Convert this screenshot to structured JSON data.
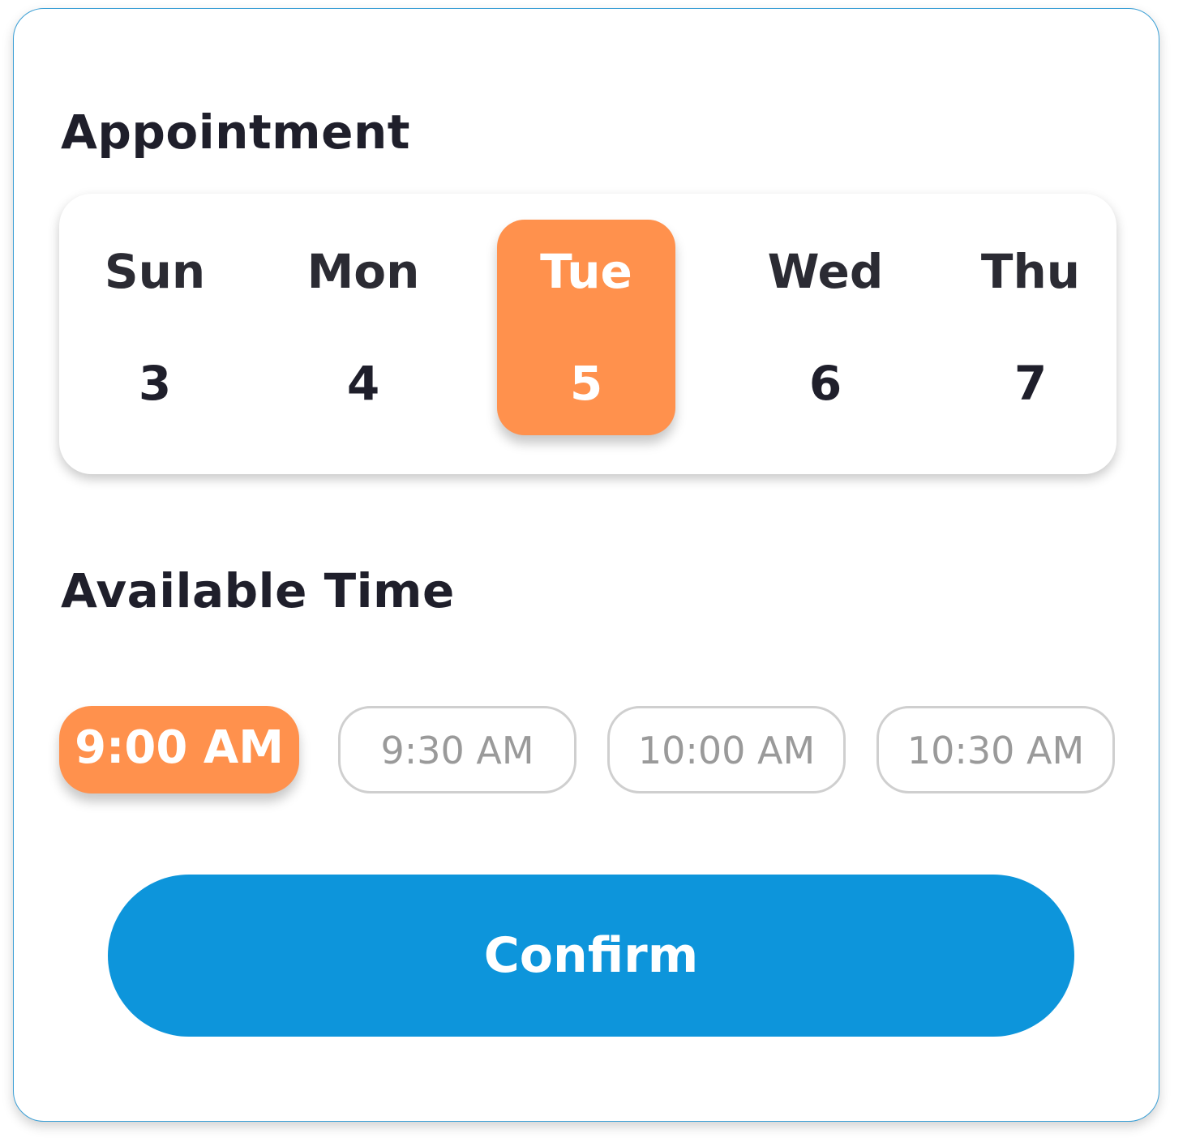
{
  "appointment": {
    "title": "Appointment",
    "days": [
      {
        "name": "Sun",
        "date": "3",
        "selected": false
      },
      {
        "name": "Mon",
        "date": "4",
        "selected": false
      },
      {
        "name": "Tue",
        "date": "5",
        "selected": true
      },
      {
        "name": "Wed",
        "date": "6",
        "selected": false
      },
      {
        "name": "Thu",
        "date": "7",
        "selected": false
      }
    ]
  },
  "available_time": {
    "title": "Available Time",
    "slots": [
      {
        "label": "9:00 AM",
        "selected": true
      },
      {
        "label": "9:30 AM",
        "selected": false
      },
      {
        "label": "10:00 AM",
        "selected": false
      },
      {
        "label": "10:30 AM",
        "selected": false
      }
    ]
  },
  "confirm_label": "Confirm",
  "colors": {
    "accent": "#ff914d",
    "primary": "#0d95db",
    "card_border": "#3a9fd6",
    "text_dark": "#1f1f2b",
    "text_muted": "#9a9a9a"
  }
}
